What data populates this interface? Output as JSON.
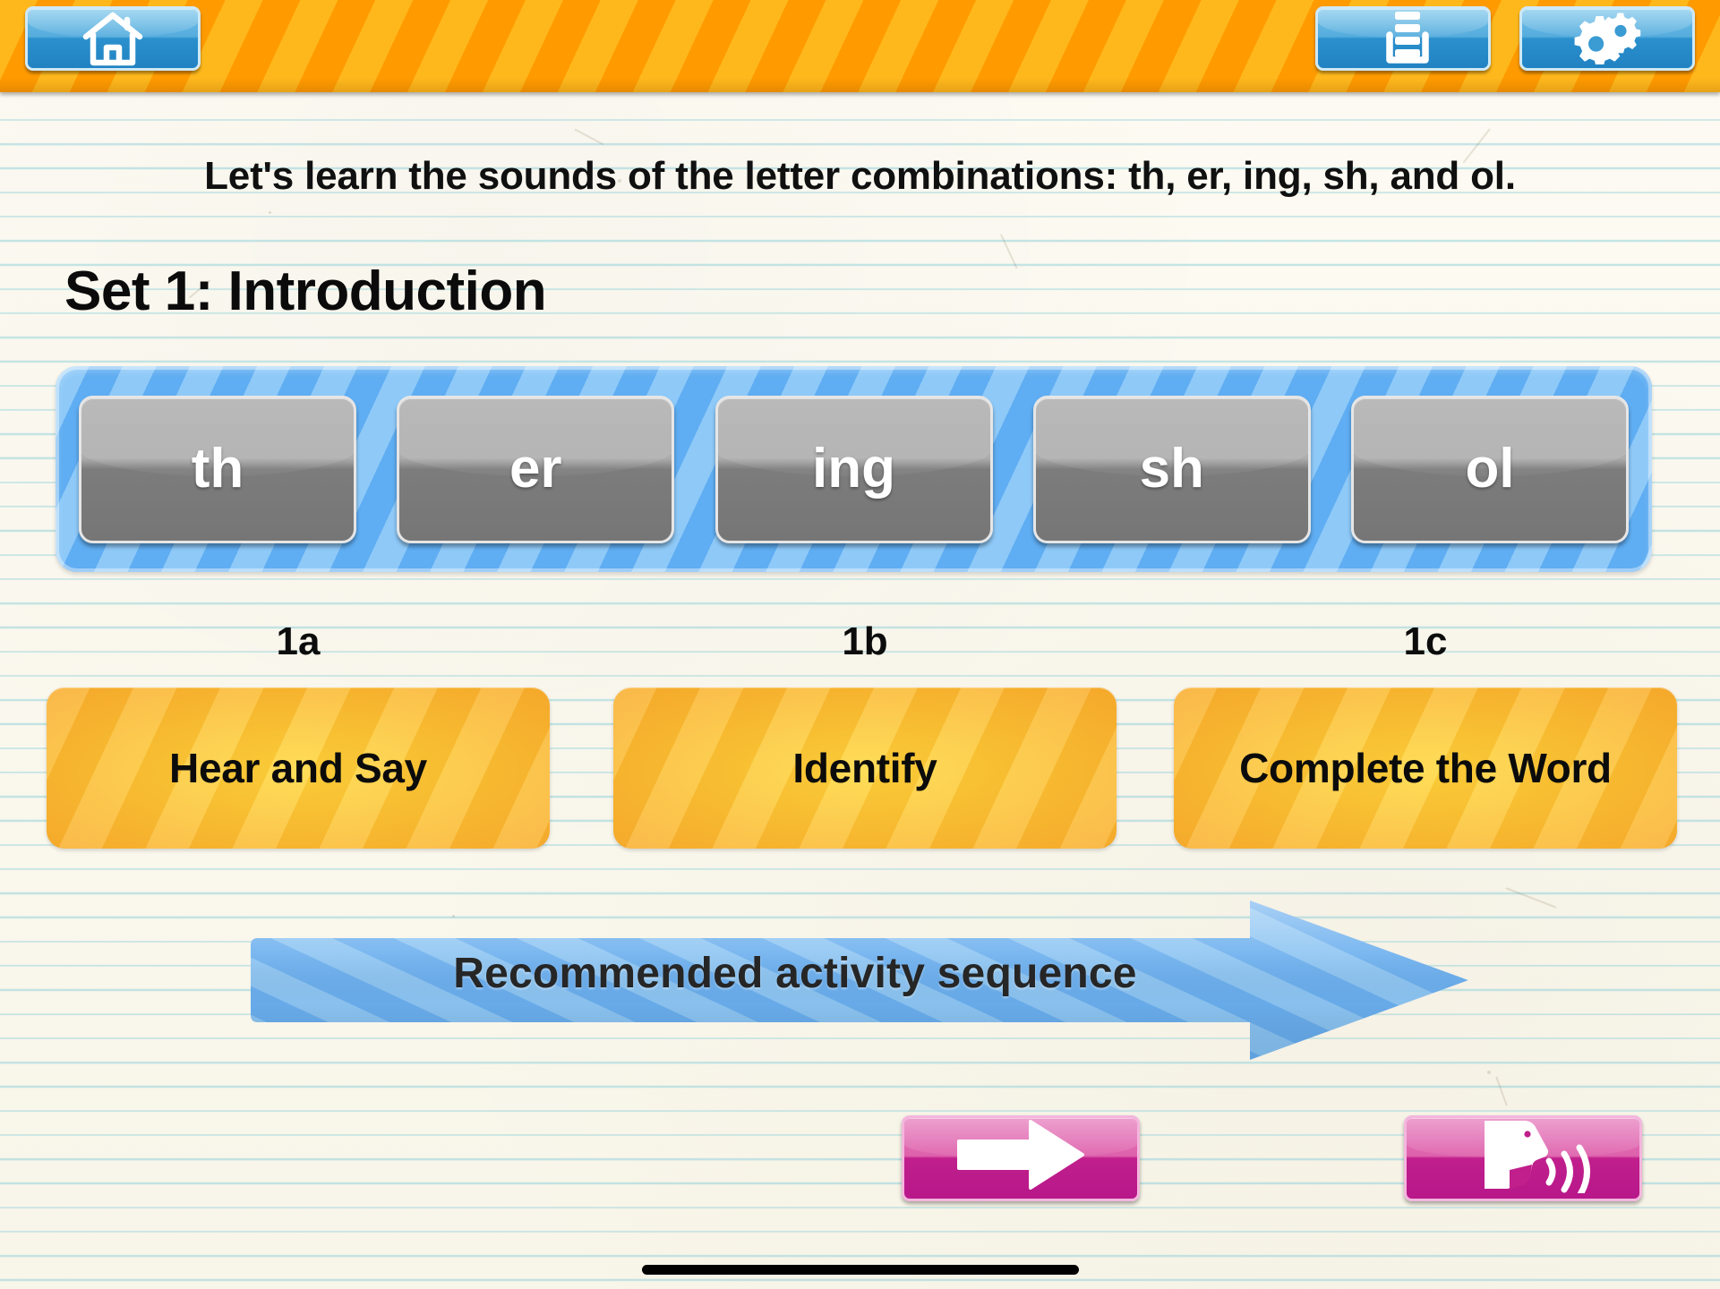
{
  "app": {
    "title": "Set 1: Introduction",
    "background": "lined-paper",
    "accent_orange": "#ffa000",
    "accent_blue": "#5fadf2",
    "accent_pink": "#c01f8c",
    "accent_yellow": "#fcc636"
  },
  "topbar": {
    "background_color": "#ffa000",
    "buttons": [
      {
        "name": "home",
        "icon": "home-icon",
        "label": "Home"
      },
      {
        "name": "list",
        "icon": "list-tray-icon",
        "label": "Activity List"
      },
      {
        "name": "settings",
        "icon": "gears-icon",
        "label": "Settings"
      }
    ]
  },
  "main": {
    "instruction": "Let's learn the sounds of the letter combinations: th, er, ing, sh, and ol.",
    "set_title": "Set 1: Introduction",
    "combinations": [
      {
        "label": "th"
      },
      {
        "label": "er"
      },
      {
        "label": "ing"
      },
      {
        "label": "sh"
      },
      {
        "label": "ol"
      }
    ],
    "activities": [
      {
        "step": "1a",
        "label": "Hear and Say"
      },
      {
        "step": "1b",
        "label": "Identify"
      },
      {
        "step": "1c",
        "label": "Complete the Word"
      }
    ],
    "sequence_banner": {
      "label": "Recommended activity sequence",
      "direction": "right"
    }
  },
  "footer": {
    "buttons": [
      {
        "name": "next",
        "icon": "arrow-right-icon",
        "label": "Next"
      },
      {
        "name": "speaker",
        "icon": "speaking-face-icon",
        "label": "Read Aloud"
      }
    ],
    "home_indicator": true
  }
}
